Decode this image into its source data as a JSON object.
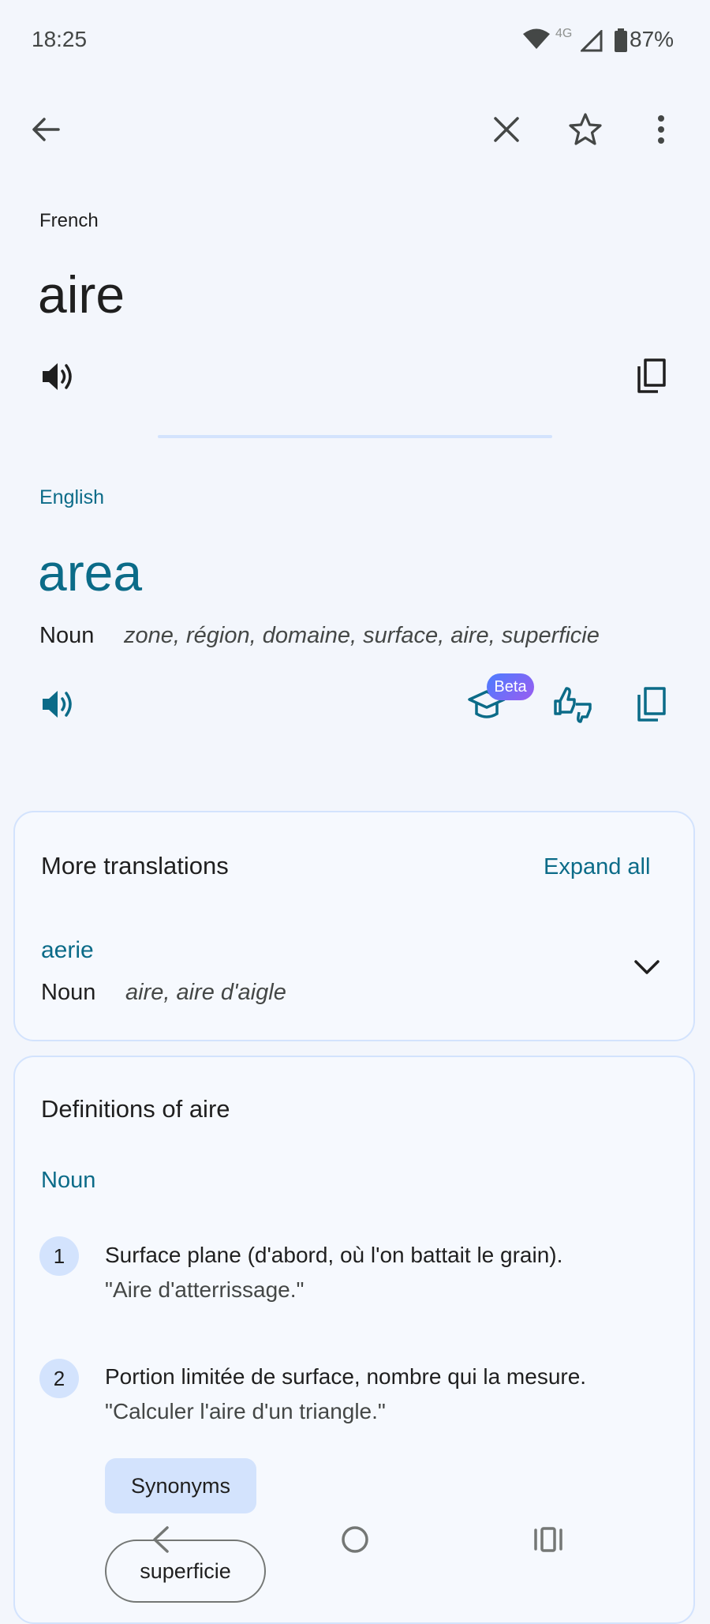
{
  "status_bar": {
    "time": "18:25",
    "network": "4G",
    "battery": "87%"
  },
  "source": {
    "language": "French",
    "text": "aire"
  },
  "target": {
    "language": "English",
    "text": "area",
    "pos": "Noun",
    "synonyms": "zone, région, domaine, surface, aire, superficie",
    "beta_label": "Beta"
  },
  "more_translations": {
    "title": "More translations",
    "expand_label": "Expand all",
    "items": [
      {
        "word": "aerie",
        "pos": "Noun",
        "translations": "aire, aire d'aigle"
      }
    ]
  },
  "definitions": {
    "title": "Definitions of aire",
    "pos": "Noun",
    "items": [
      {
        "number": "1",
        "text": "Surface plane (d'abord, où l'on battait le grain).",
        "example": "\"Aire d'atterrissage.\""
      },
      {
        "number": "2",
        "text": "Portion limitée de surface, nombre qui la mesure.",
        "example": "\"Calculer l'aire d'un triangle.\""
      }
    ],
    "synonyms_label": "Synonyms",
    "synonym_chip": "superficie"
  },
  "icons": {
    "back": "arrow-left-icon",
    "close": "close-icon",
    "star": "star-icon",
    "menu": "more-vert-icon",
    "speaker": "speaker-icon",
    "copy": "copy-icon",
    "learn": "graduation-cap-icon",
    "feedback": "thumbs-feedback-icon"
  },
  "colors": {
    "accent": "#0b6b88",
    "background": "#f3f6fc",
    "card_border": "#d3e3fd",
    "chip": "#d3e3fd"
  }
}
